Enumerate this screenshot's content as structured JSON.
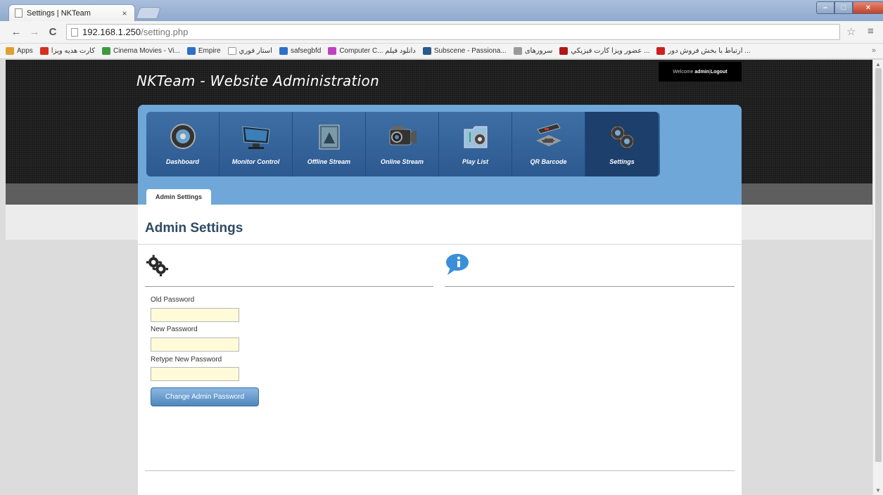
{
  "browser": {
    "tab_title": "Settings | NKTeam",
    "tab_close": "×",
    "url_host": "192.168.1.250",
    "url_path": "/setting.php",
    "back": "←",
    "forward": "→",
    "reload": "C",
    "star": "☆",
    "menu": "≡",
    "window_min": "–",
    "window_max": "□",
    "window_close": "×",
    "bookmarks_more": "»",
    "bookmarks": [
      {
        "label": "Apps",
        "color": "#e0a030"
      },
      {
        "label": "كارت هديه ويزا",
        "color": "#d63020"
      },
      {
        "label": "Cinema Movies - Vi...",
        "color": "#3f9a3f"
      },
      {
        "label": "Empire",
        "color": "#2e6fc9"
      },
      {
        "label": "استار فوري",
        "color": "#ffffff"
      },
      {
        "label": "safsegbfd",
        "color": "#2e6fc9"
      },
      {
        "label": "Computer C... دانلود فیلم",
        "color": "#c040c0"
      },
      {
        "label": "Subscene - Passiona...",
        "color": "#2a5a8a"
      },
      {
        "label": "سرورهای",
        "color": "#999999"
      },
      {
        "label": "عضور ويزا كارت فيزيكي ...",
        "color": "#b01818"
      },
      {
        "label": "ارتباط با بخش فروش دور ...",
        "color": "#cc2020"
      }
    ]
  },
  "site": {
    "title": "NKTeam - Website Administration",
    "welcome_prefix": "Welcome ",
    "welcome_user": "admin",
    "welcome_sep": " | ",
    "logout": "Logout"
  },
  "nav": {
    "items": [
      {
        "label": "Dashboard",
        "icon": "dashboard-icon"
      },
      {
        "label": "Monitor Control",
        "icon": "monitor-icon"
      },
      {
        "label": "Offline Stream",
        "icon": "offline-stream-icon"
      },
      {
        "label": "Online Stream",
        "icon": "camcorder-icon"
      },
      {
        "label": "Play List",
        "icon": "music-folder-icon"
      },
      {
        "label": "QR Barcode",
        "icon": "barcode-scanner-icon"
      },
      {
        "label": "Settings",
        "icon": "gears-icon"
      }
    ],
    "active_index": 6
  },
  "subtab": {
    "label": "Admin Settings"
  },
  "page": {
    "title": "Admin Settings",
    "form": {
      "old_password_label": "Old Password",
      "old_password_value": "",
      "new_password_label": "New Password",
      "new_password_value": "",
      "retype_password_label": "Retype New Password",
      "retype_password_value": "",
      "submit_label": "Change Admin Password"
    }
  },
  "colors": {
    "header_bg": "#1a1a1a",
    "panel_blue": "#6fa7d8",
    "nav_blue": "#2c5990",
    "nav_active": "#1c3f6c",
    "input_bg": "#fffbd9",
    "button_blue": "#4f86bd"
  }
}
